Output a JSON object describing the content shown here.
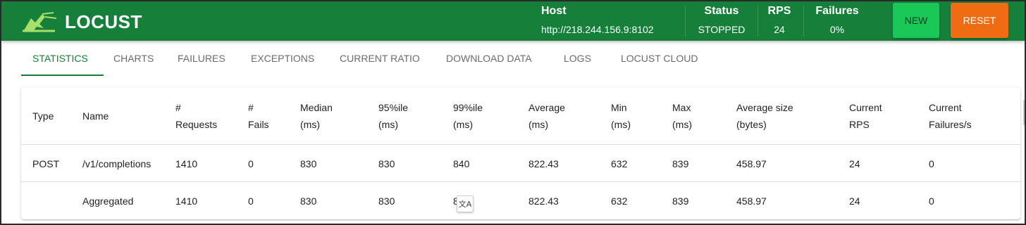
{
  "app": {
    "brand": "LOCUST",
    "brand_color": "#16803b"
  },
  "header": {
    "host_label": "Host",
    "host_value": "http://218.244.156.9:8102",
    "status_label": "Status",
    "status_value": "STOPPED",
    "rps_label": "RPS",
    "rps_value": "24",
    "failures_label": "Failures",
    "failures_value": "0%",
    "new_button": "NEW",
    "reset_button": "RESET"
  },
  "tabs": [
    {
      "label": "STATISTICS",
      "active": true
    },
    {
      "label": "CHARTS"
    },
    {
      "label": "FAILURES"
    },
    {
      "label": "EXCEPTIONS"
    },
    {
      "label": "CURRENT RATIO"
    },
    {
      "label": "DOWNLOAD DATA"
    },
    {
      "label": "LOGS"
    },
    {
      "label": "LOCUST CLOUD"
    }
  ],
  "table": {
    "headers": [
      [
        "Type"
      ],
      [
        "Name"
      ],
      [
        "#",
        "Requests"
      ],
      [
        "#",
        "Fails"
      ],
      [
        "Median",
        "(ms)"
      ],
      [
        "95%ile",
        "(ms)"
      ],
      [
        "99%ile",
        "(ms)"
      ],
      [
        "Average",
        "(ms)"
      ],
      [
        "Min",
        "(ms)"
      ],
      [
        "Max",
        "(ms)"
      ],
      [
        "Average size",
        "(bytes)"
      ],
      [
        "Current",
        "RPS"
      ],
      [
        "Current",
        "Failures/s"
      ]
    ],
    "rows": [
      [
        "POST",
        "/v1/completions",
        "1410",
        "0",
        "830",
        "830",
        "840",
        "822.43",
        "632",
        "839",
        "458.97",
        "24",
        "0"
      ],
      [
        "",
        "Aggregated",
        "1410",
        "0",
        "830",
        "830",
        "8",
        "822.43",
        "632",
        "839",
        "458.97",
        "24",
        "0"
      ]
    ]
  },
  "overlay": {
    "icon": "translate-icon",
    "glyph": "文A"
  }
}
